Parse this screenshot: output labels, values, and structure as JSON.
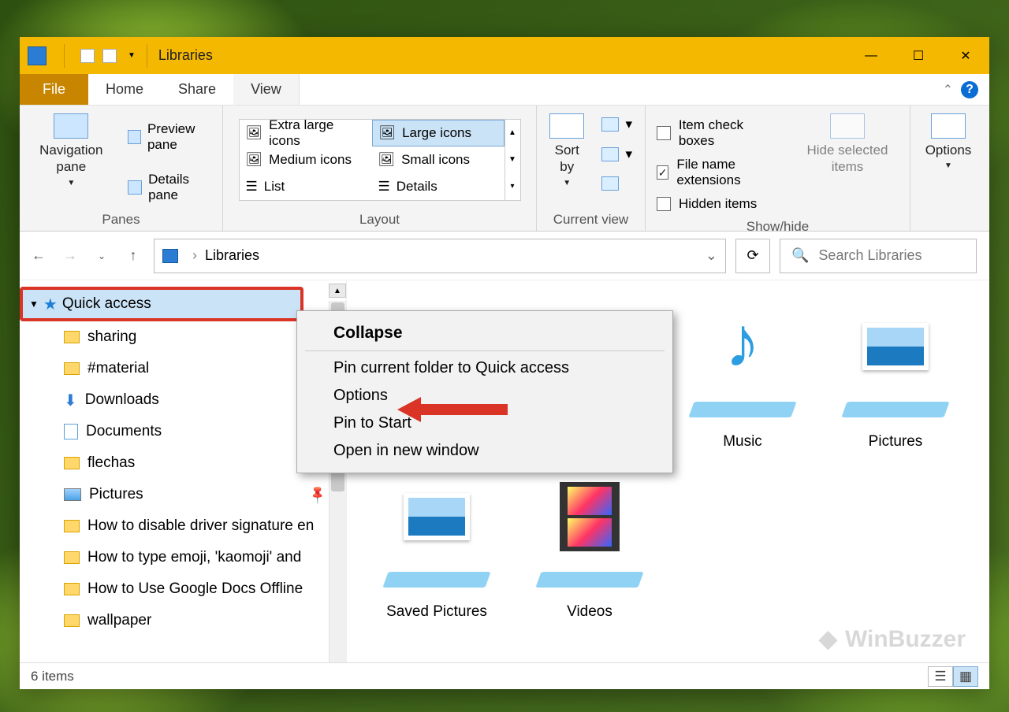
{
  "window": {
    "title": "Libraries"
  },
  "tabs": {
    "file": "File",
    "home": "Home",
    "share": "Share",
    "view": "View"
  },
  "ribbon": {
    "panes": {
      "label": "Panes",
      "nav": "Navigation pane",
      "preview": "Preview pane",
      "details": "Details pane"
    },
    "layout": {
      "label": "Layout",
      "xl": "Extra large icons",
      "lg": "Large icons",
      "md": "Medium icons",
      "sm": "Small icons",
      "list": "List",
      "det": "Details"
    },
    "current": {
      "label": "Current view",
      "sort": "Sort by"
    },
    "show": {
      "label": "Show/hide",
      "checkboxes": "Item check boxes",
      "ext": "File name extensions",
      "hidden": "Hidden items",
      "hidesel": "Hide selected items"
    },
    "options": "Options"
  },
  "addr": {
    "crumb": "Libraries"
  },
  "search": {
    "placeholder": "Search Libraries"
  },
  "nav": {
    "quick": "Quick access",
    "items": [
      {
        "label": "sharing",
        "type": "folder",
        "pin": false
      },
      {
        "label": "#material",
        "type": "folder",
        "pin": false
      },
      {
        "label": "Downloads",
        "type": "download",
        "pin": false
      },
      {
        "label": "Documents",
        "type": "doc",
        "pin": false
      },
      {
        "label": "flechas",
        "type": "folder",
        "pin": true
      },
      {
        "label": "Pictures",
        "type": "pic",
        "pin": true
      },
      {
        "label": "How to disable driver signature en",
        "type": "folder",
        "pin": false
      },
      {
        "label": "How to type emoji, 'kaomoji' and",
        "type": "folder",
        "pin": false
      },
      {
        "label": "How to Use Google Docs Offline",
        "type": "folder",
        "pin": false
      },
      {
        "label": "wallpaper",
        "type": "folder",
        "pin": false
      }
    ]
  },
  "libs": {
    "music": "Music",
    "pictures": "Pictures",
    "saved": "Saved Pictures",
    "videos": "Videos"
  },
  "ctx": {
    "collapse": "Collapse",
    "pin_qa": "Pin current folder to Quick access",
    "options": "Options",
    "pin_start": "Pin to Start",
    "new_window": "Open in new window"
  },
  "status": {
    "count": "6 items"
  },
  "watermark": "WinBuzzer"
}
